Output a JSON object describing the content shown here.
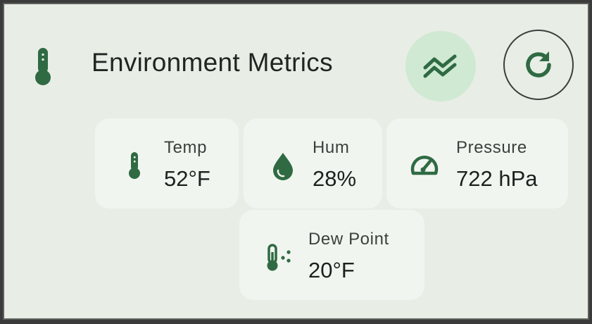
{
  "header": {
    "title": "Environment Metrics",
    "icon": "thermometer-icon",
    "trend_button_icon": "trending-icon",
    "refresh_button_icon": "refresh-icon"
  },
  "metrics": [
    {
      "label": "Temp",
      "value": "52°F",
      "icon": "thermometer-icon"
    },
    {
      "label": "Hum",
      "value": "28%",
      "icon": "water-drop-icon"
    },
    {
      "label": "Pressure",
      "value": "722 hPa",
      "icon": "gauge-icon"
    },
    {
      "label": "Dew Point",
      "value": "20°F",
      "icon": "dew-point-icon"
    }
  ],
  "colors": {
    "accent": "#2f6a43",
    "card_background": "#e8ede6",
    "tile_background": "#f1f5ef",
    "trend_button_background": "#cfe9d2"
  }
}
